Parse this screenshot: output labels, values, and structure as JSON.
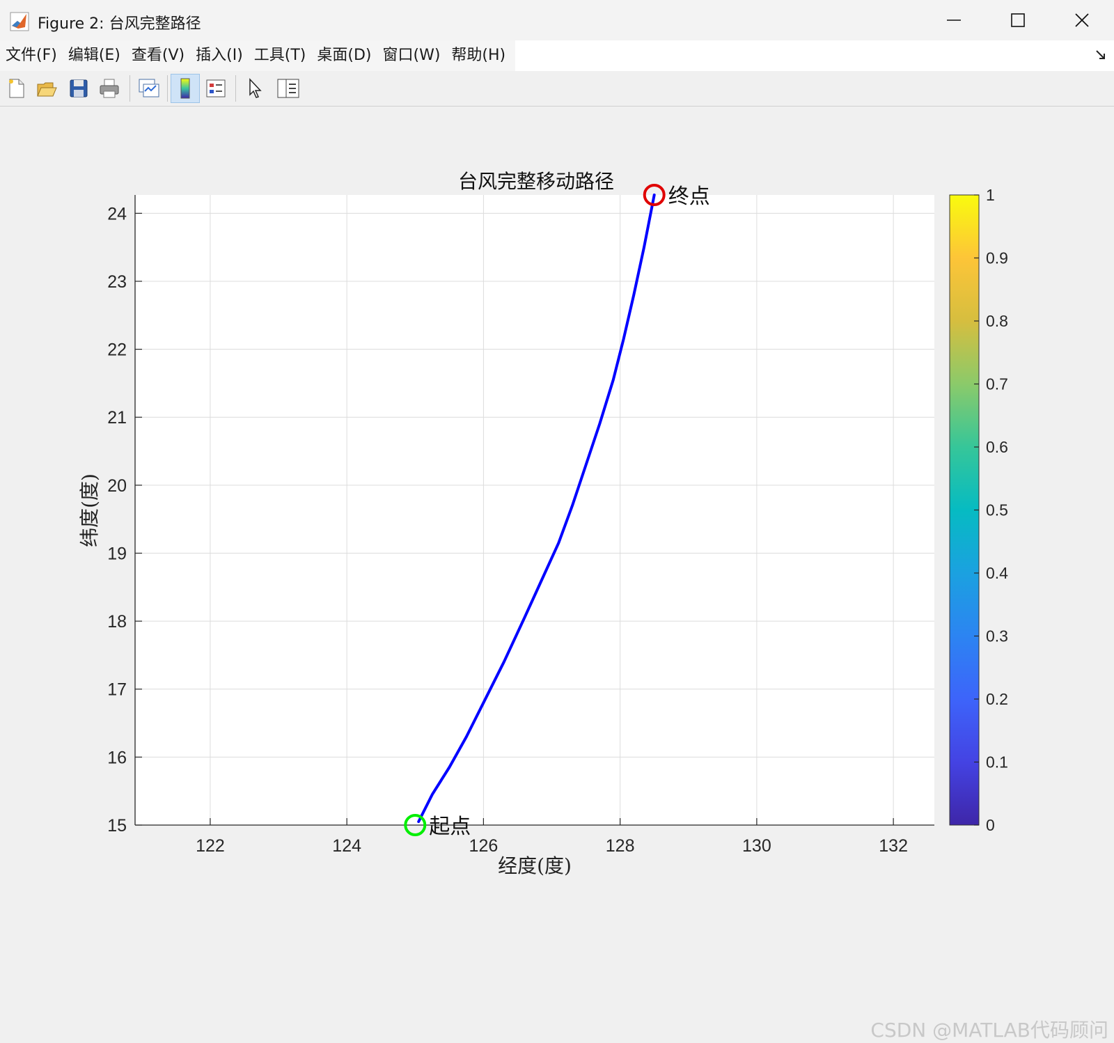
{
  "window": {
    "title": "Figure 2: 台风完整路径"
  },
  "menu": {
    "items": [
      "文件(F)",
      "编辑(E)",
      "查看(V)",
      "插入(I)",
      "工具(T)",
      "桌面(D)",
      "窗口(W)",
      "帮助(H)"
    ]
  },
  "toolbar": {
    "buttons": [
      "new-figure-icon",
      "open-file-icon",
      "save-icon",
      "print-icon",
      "link-plot-icon",
      "insert-colorbar-icon",
      "insert-legend-icon",
      "pointer-icon",
      "property-inspector-icon"
    ]
  },
  "chart_data": {
    "type": "line",
    "title": "台风完整移动路径",
    "xlabel": "经度(度)",
    "ylabel": "纬度(度)",
    "xlim": [
      120.9,
      132.6
    ],
    "ylim": [
      15,
      24.27
    ],
    "xticks": [
      122,
      124,
      126,
      128,
      130,
      132
    ],
    "yticks": [
      15,
      16,
      17,
      18,
      19,
      20,
      21,
      22,
      23,
      24
    ],
    "grid": true,
    "series": [
      {
        "color": "#0000ff",
        "x": [
          125.05,
          125.25,
          125.5,
          125.75,
          126.0,
          126.3,
          126.6,
          126.85,
          127.1,
          127.3,
          127.5,
          127.7,
          127.9,
          128.05,
          128.2,
          128.35,
          128.5
        ],
        "y": [
          15.05,
          15.45,
          15.85,
          16.3,
          16.8,
          17.4,
          18.05,
          18.6,
          19.15,
          19.7,
          20.3,
          20.9,
          21.55,
          22.15,
          22.8,
          23.5,
          24.27
        ]
      }
    ],
    "markers": [
      {
        "label": "起点",
        "x": 125.0,
        "y": 15.0,
        "color": "#00ee00"
      },
      {
        "label": "终点",
        "x": 128.5,
        "y": 24.27,
        "color": "#e00000"
      }
    ],
    "colorbar": {
      "ticks": [
        "0",
        "0.1",
        "0.2",
        "0.3",
        "0.4",
        "0.5",
        "0.6",
        "0.7",
        "0.8",
        "0.9",
        "1"
      ],
      "range": [
        0,
        1
      ],
      "colormap": "parula"
    }
  },
  "watermark": "CSDN @MATLAB代码顾问"
}
